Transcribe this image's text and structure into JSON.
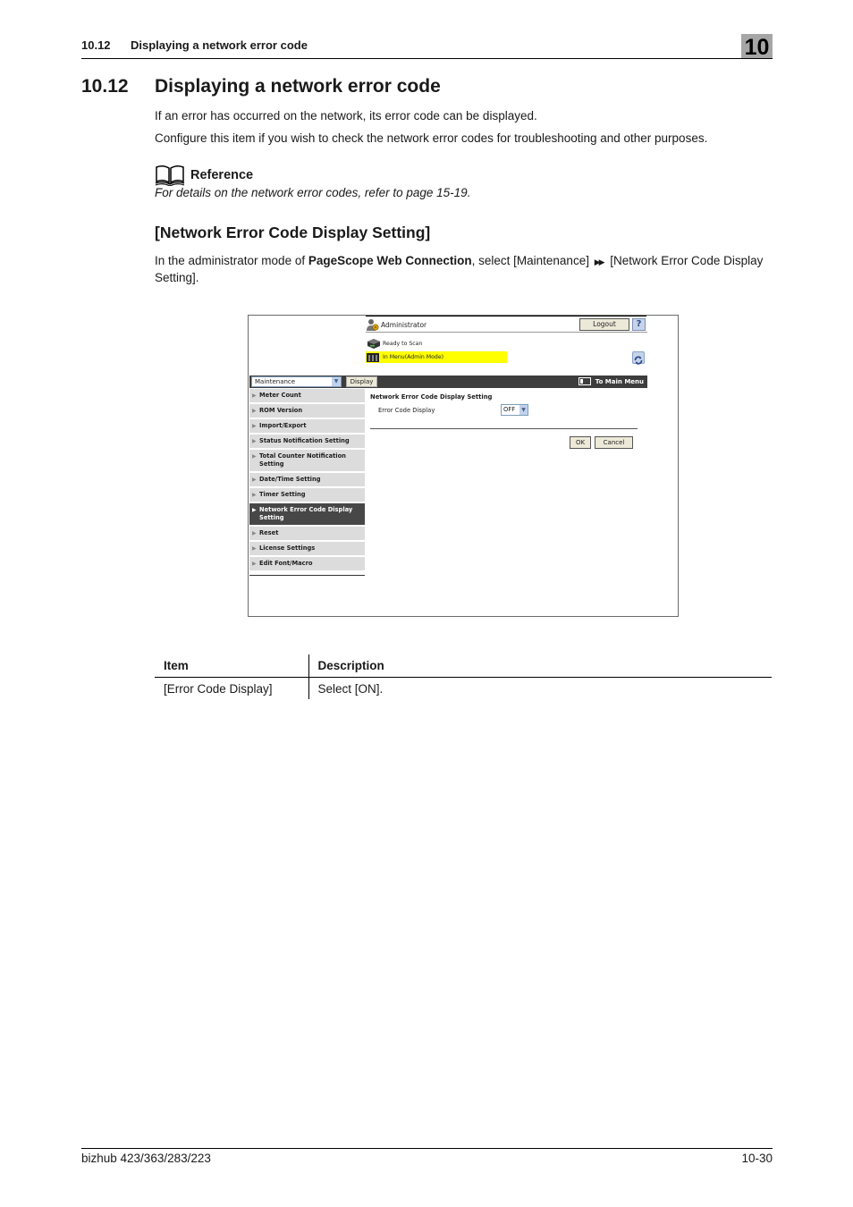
{
  "running_header": {
    "section_number": "10.12",
    "section_title": "Displaying a network error code",
    "chapter_number": "10"
  },
  "section": {
    "number": "10.12",
    "title": "Displaying a network error code"
  },
  "intro": {
    "paragraph_1": "If an error has occurred on the network, its error code can be displayed.",
    "paragraph_2": "Configure this item if you wish to check the network error codes for troubleshooting and other purposes."
  },
  "reference": {
    "icon": "book-icon",
    "heading": "Reference",
    "text": "For details on the network error codes, refer to page 15-19."
  },
  "subsection": {
    "title": "[Network Error Code Display Setting]",
    "instruction_prefix": "In the administrator mode of ",
    "instruction_app": "PageScope Web Connection",
    "instruction_middle": ", select [Maintenance] ",
    "instruction_arrow": "▶▶",
    "instruction_suffix": " [Network Error Code Display Setting]."
  },
  "screenshot": {
    "user_label": "Administrator",
    "logout_label": "Logout",
    "help_label": "?",
    "status_ready": "Ready to Scan",
    "status_menu": "In Menu(Admin Mode)",
    "status_menu_highlight": "#ffff00",
    "nav_select_value": "Maintenance",
    "display_button": "Display",
    "main_menu_label": "To Main Menu",
    "menu_items": [
      {
        "label": "Meter Count",
        "active": false
      },
      {
        "label": "ROM Version",
        "active": false
      },
      {
        "label": "Import/Export",
        "active": false
      },
      {
        "label": "Status Notification Setting",
        "active": false
      },
      {
        "label": "Total Counter Notification Setting",
        "active": false
      },
      {
        "label": "Date/Time Setting",
        "active": false
      },
      {
        "label": "Timer Setting",
        "active": false
      },
      {
        "label": "Network Error Code Display Setting",
        "active": true
      },
      {
        "label": "Reset",
        "active": false
      },
      {
        "label": "License Settings",
        "active": false
      },
      {
        "label": "Edit Font/Macro",
        "active": false
      }
    ],
    "content_title": "Network Error Code Display Setting",
    "field_label": "Error Code Display",
    "field_value": "OFF",
    "ok_label": "OK",
    "cancel_label": "Cancel"
  },
  "table": {
    "headers": [
      "Item",
      "Description"
    ],
    "rows": [
      [
        "[Error Code Display]",
        "Select [ON]."
      ]
    ]
  },
  "footer": {
    "product": "bizhub 423/363/283/223",
    "page": "10-30"
  }
}
